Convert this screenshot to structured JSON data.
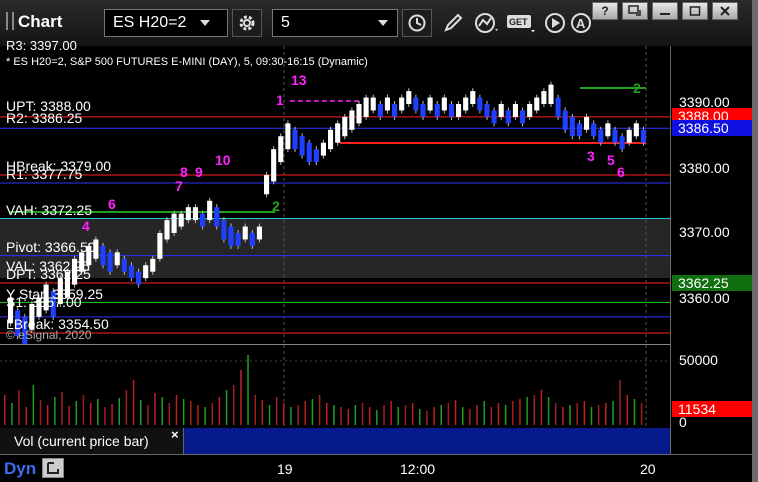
{
  "toolbar": {
    "title": "Chart",
    "symbol": "ES H20=2",
    "interval": "5"
  },
  "chart": {
    "header": "* ES H20=2, S&P 500 FUTURES E-MINI (DAY), 5, 09:30-16:15 (Dynamic)",
    "copyright": "© eSignal, 2020",
    "top_cut_label": "R3: 3397.00",
    "levels": [
      {
        "key": "upt",
        "label": "UPT: 3388.00",
        "price": 3388.0,
        "color": "#ff2020"
      },
      {
        "key": "r2",
        "label": "R2: 3386.25",
        "price": 3386.25,
        "color": "#3030ff"
      },
      {
        "key": "hbreak",
        "label": "HBreak: 3379.00",
        "price": 3379.0,
        "color": "#ff2020"
      },
      {
        "key": "r1",
        "label": "R1: 3377.75",
        "price": 3377.75,
        "color": "#3030ff"
      },
      {
        "key": "vah",
        "label": "VAH: 3372.25",
        "price": 3372.25,
        "color": "#20d0d0"
      },
      {
        "key": "pivot",
        "label": "Pivot: 3366.50",
        "price": 3366.5,
        "color": "#3030ff"
      },
      {
        "key": "val",
        "label": "VAL: 3362.25",
        "price": 3362.25,
        "color": "#20d0d0"
      },
      {
        "key": "dpt",
        "label": "DPT: 3362.25",
        "price": 3362.25,
        "color": "#ff2020"
      },
      {
        "key": "ystar",
        "label": "Y Star: 3359.25",
        "price": 3359.25,
        "color": "#20d020"
      },
      {
        "key": "s1",
        "label": "S1: 3357.00",
        "price": 3357.0,
        "color": "#3030ff"
      },
      {
        "key": "lbreak",
        "label": "LBreak: 3354.50",
        "price": 3354.5,
        "color": "#ff2020"
      }
    ],
    "price_axis": {
      "ticks": [
        "3390.00",
        "3380.00",
        "3370.00",
        "3360.00"
      ],
      "tick_values": [
        3390,
        3380,
        3370,
        3360
      ],
      "last_red_tag": "3388.00",
      "last_price_tag": "3386.50",
      "green_tag": "3362.25",
      "colors": {
        "red": "#ff0000",
        "blue": "#1010e0",
        "green": "#107010"
      }
    },
    "counts": [
      {
        "text": "4",
        "color": "#ff20ff"
      },
      {
        "text": "6",
        "color": "#ff20ff"
      },
      {
        "text": "7",
        "color": "#ff20ff"
      },
      {
        "text": "8",
        "color": "#ff20ff"
      },
      {
        "text": "9",
        "color": "#ff20ff"
      },
      {
        "text": "10",
        "color": "#ff20ff"
      },
      {
        "text": "13",
        "color": "#ff20ff"
      },
      {
        "text": "1",
        "color": "#ff20ff"
      },
      {
        "text": "2",
        "color": "#20a020"
      },
      {
        "text": "2",
        "color": "#20a020"
      },
      {
        "text": "3",
        "color": "#ff20ff"
      },
      {
        "text": "5",
        "color": "#ff20ff"
      },
      {
        "text": "6",
        "color": "#ff20ff"
      }
    ]
  },
  "volume": {
    "label": "Vol (current price bar)",
    "close_glyph": "×",
    "ticks": [
      "50000",
      "0"
    ],
    "current_tag": "11534"
  },
  "bottom": {
    "dyn": "Dyn",
    "times": [
      "19",
      "12:00",
      "20"
    ]
  }
}
